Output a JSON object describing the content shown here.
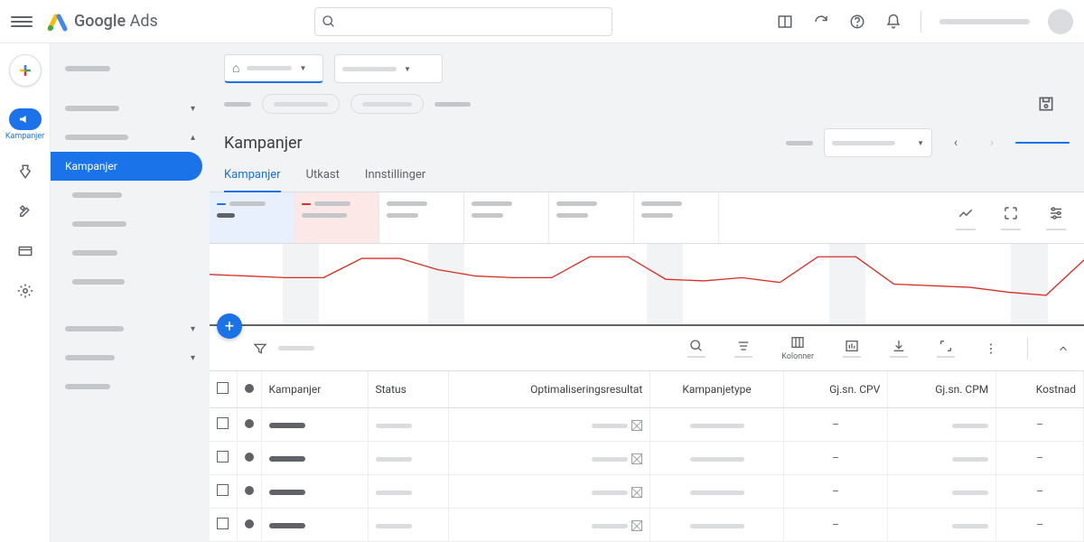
{
  "header": {
    "logo_text_1": "Google",
    "logo_text_2": "Ads",
    "search_placeholder": ""
  },
  "rail": {
    "campaigns_label": "Kampanjer"
  },
  "sidebar": {
    "selected_label": "Kampanjer"
  },
  "page": {
    "title": "Kampanjer"
  },
  "tabs": [
    {
      "label": "Kampanjer",
      "active": true
    },
    {
      "label": "Utkast",
      "active": false
    },
    {
      "label": "Innstillinger",
      "active": false
    }
  ],
  "toolbar": {
    "columns_label": "Kolonner"
  },
  "table": {
    "headers": {
      "campaigns": "Kampanjer",
      "status": "Status",
      "optimization": "Optimaliseringsresultat",
      "type": "Kampanjetype",
      "cpv": "Gj.sn. CPV",
      "cpm": "Gj.sn. CPM",
      "cost": "Kostnad"
    },
    "rows": [
      {
        "cpv": "–",
        "cost": "–"
      },
      {
        "cpv": "–",
        "cost": "–"
      },
      {
        "cpv": "–",
        "cost": "–"
      },
      {
        "cpv": "–",
        "cost": "–"
      }
    ]
  },
  "chart_data": {
    "type": "line",
    "series": [
      {
        "name": "metric-red",
        "color": "#d93025",
        "values": [
          62,
          60,
          58,
          58,
          82,
          82,
          68,
          60,
          58,
          58,
          84,
          84,
          56,
          54,
          58,
          52,
          84,
          84,
          50,
          48,
          46,
          40,
          36,
          80
        ]
      }
    ],
    "shaded_columns": [
      2,
      6,
      12,
      17,
      22
    ],
    "ylim": [
      0,
      100
    ]
  }
}
